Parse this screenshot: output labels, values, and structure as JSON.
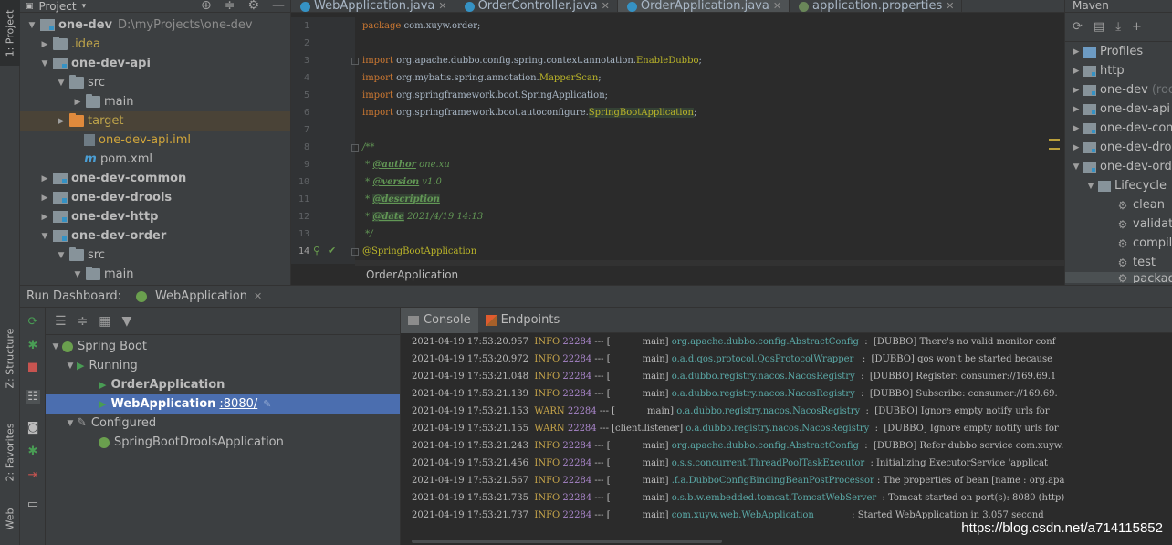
{
  "left_stripe": {
    "project_tab": "1: Project",
    "structure_tab": "Z: Structure",
    "favorites_tab": "2: Favorites",
    "web_tab": "Web"
  },
  "project": {
    "title": "Project",
    "tree": [
      {
        "label": "one-dev",
        "path": "D:\\myProjects\\one-dev"
      },
      {
        "label": ".idea"
      },
      {
        "label": "one-dev-api"
      },
      {
        "label": "src"
      },
      {
        "label": "main"
      },
      {
        "label": "target"
      },
      {
        "label": "one-dev-api.iml"
      },
      {
        "label": "pom.xml"
      },
      {
        "label": "one-dev-common"
      },
      {
        "label": "one-dev-drools"
      },
      {
        "label": "one-dev-http"
      },
      {
        "label": "one-dev-order"
      },
      {
        "label": "src"
      },
      {
        "label": "main"
      }
    ]
  },
  "editor": {
    "tabs": [
      {
        "label": "WebApplication.java"
      },
      {
        "label": "OrderController.java"
      },
      {
        "label": "OrderApplication.java",
        "active": true
      },
      {
        "label": "application.properties"
      }
    ],
    "line_numbers": [
      "1",
      "2",
      "3",
      "4",
      "5",
      "6",
      "7",
      "8",
      "9",
      "10",
      "11",
      "12",
      "13",
      "14"
    ],
    "code": {
      "l1_kw": "package",
      "l1_rest": " com.xuyw.order;",
      "l3_kw": "import",
      "l3_rest": " org.apache.dubbo.config.spring.context.annotation.",
      "l3_ann": "EnableDubbo",
      "l3_end": ";",
      "l4_kw": "import",
      "l4_rest": " org.mybatis.spring.annotation.",
      "l4_ann": "MapperScan",
      "l4_end": ";",
      "l5_kw": "import",
      "l5_rest": " org.springframework.boot.SpringApplication;",
      "l6_kw": "import",
      "l6_rest": " org.springframework.boot.autoconfigure.",
      "l6_ann": "SpringBootApplication",
      "l6_end": ";",
      "l8": "/**",
      "l9_pre": " * ",
      "l9_tag": "@author",
      "l9_val": " one.xu",
      "l10_pre": " * ",
      "l10_tag": "@version",
      "l10_val": " v1.0",
      "l11_pre": " * ",
      "l11_tag": "@description",
      "l12_pre": " * ",
      "l12_tag": "@date",
      "l12_val": " 2021/4/19 14:13",
      "l13": " */",
      "l14": "@SpringBootApplication"
    },
    "breadcrumb": "OrderApplication"
  },
  "maven": {
    "title": "Maven",
    "items": [
      {
        "label": "Profiles"
      },
      {
        "label": "http"
      },
      {
        "label": "one-dev",
        "suffix": "(roo"
      },
      {
        "label": "one-dev-api"
      },
      {
        "label": "one-dev-com"
      },
      {
        "label": "one-dev-droo"
      },
      {
        "label": "one-dev-orde"
      },
      {
        "label": "Lifecycle"
      },
      {
        "label": "clean"
      },
      {
        "label": "validate"
      },
      {
        "label": "compile"
      },
      {
        "label": "test"
      },
      {
        "label": "package"
      }
    ]
  },
  "run": {
    "title": "Run Dashboard:",
    "tab": "WebApplication",
    "tree": {
      "spring_boot": "Spring Boot",
      "running": "Running",
      "order_app": "OrderApplication",
      "web_app": "WebApplication",
      "web_port": ":8080/",
      "configured": "Configured",
      "drools_app": "SpringBootDroolsApplication"
    }
  },
  "console": {
    "tabs": [
      "Console",
      "Endpoints"
    ],
    "logs": [
      {
        "ts": "2021-04-19 17:53:20.957",
        "lvl": "INFO",
        "pid": "22284",
        "thread": "[           main]",
        "logger": "org.apache.dubbo.config.AbstractConfig",
        "msg": "  :  [DUBBO] There's no valid monitor conf"
      },
      {
        "ts": "2021-04-19 17:53:20.972",
        "lvl": "INFO",
        "pid": "22284",
        "thread": "[           main]",
        "logger": "o.a.d.qos.protocol.QosProtocolWrapper",
        "msg": "   :  [DUBBO] qos won't be started because"
      },
      {
        "ts": "2021-04-19 17:53:21.048",
        "lvl": "INFO",
        "pid": "22284",
        "thread": "[           main]",
        "logger": "o.a.dubbo.registry.nacos.NacosRegistry",
        "msg": "  :  [DUBBO] Register: consumer://169.69.1"
      },
      {
        "ts": "2021-04-19 17:53:21.139",
        "lvl": "INFO",
        "pid": "22284",
        "thread": "[           main]",
        "logger": "o.a.dubbo.registry.nacos.NacosRegistry",
        "msg": "  :  [DUBBO] Subscribe: consumer://169.69."
      },
      {
        "ts": "2021-04-19 17:53:21.153",
        "lvl": "WARN",
        "pid": "22284",
        "thread": "[           main]",
        "logger": "o.a.dubbo.registry.nacos.NacosRegistry",
        "msg": "  :  [DUBBO] Ignore empty notify urls for"
      },
      {
        "ts": "2021-04-19 17:53:21.155",
        "lvl": "WARN",
        "pid": "22284",
        "thread": "[client.listener]",
        "logger": "o.a.dubbo.registry.nacos.NacosRegistry",
        "msg": "  :  [DUBBO] Ignore empty notify urls for"
      },
      {
        "ts": "2021-04-19 17:53:21.243",
        "lvl": "INFO",
        "pid": "22284",
        "thread": "[           main]",
        "logger": "org.apache.dubbo.config.AbstractConfig",
        "msg": "  :  [DUBBO] Refer dubbo service com.xuyw."
      },
      {
        "ts": "2021-04-19 17:53:21.456",
        "lvl": "INFO",
        "pid": "22284",
        "thread": "[           main]",
        "logger": "o.s.s.concurrent.ThreadPoolTaskExecutor",
        "msg": "  : Initializing ExecutorService 'applicat"
      },
      {
        "ts": "2021-04-19 17:53:21.567",
        "lvl": "INFO",
        "pid": "22284",
        "thread": "[           main]",
        "logger": ".f.a.DubboConfigBindingBeanPostProcessor",
        "msg": " : The properties of bean [name : org.apa"
      },
      {
        "ts": "2021-04-19 17:53:21.735",
        "lvl": "INFO",
        "pid": "22284",
        "thread": "[           main]",
        "logger": "o.s.b.w.embedded.tomcat.TomcatWebServer",
        "msg": "  : Tomcat started on port(s): 8080 (http)"
      },
      {
        "ts": "2021-04-19 17:53:21.737",
        "lvl": "INFO",
        "pid": "22284",
        "thread": "[           main]",
        "logger": "com.xuyw.web.WebApplication",
        "msg": "             : Started WebApplication in 3.057 second"
      }
    ],
    "watermark": "https://blog.csdn.net/a714115852"
  }
}
